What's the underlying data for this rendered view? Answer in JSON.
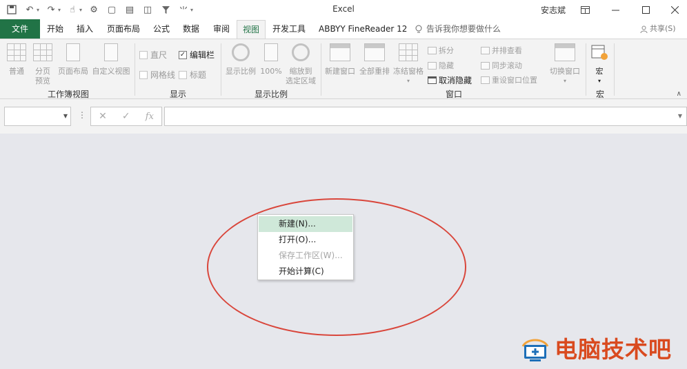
{
  "window": {
    "app_title": "Excel",
    "user_name": "安志斌"
  },
  "tabs": {
    "file": "文件",
    "home": "开始",
    "insert": "插入",
    "page_layout": "页面布局",
    "formulas": "公式",
    "data": "数据",
    "review": "审阅",
    "view": "视图",
    "developer": "开发工具",
    "abbyy": "ABBYY FineReader 12",
    "tell_me": "告诉我你想要做什么",
    "share": "共享(S)"
  },
  "ribbon": {
    "workbook_views": {
      "label": "工作簿视图",
      "normal": "普通",
      "page_break_line1": "分页",
      "page_break_line2": "预览",
      "page_layout": "页面布局",
      "custom_views": "自定义视图"
    },
    "show": {
      "label": "显示",
      "ruler": "直尺",
      "formula_bar": "编辑栏",
      "gridlines": "网格线",
      "headings": "标题",
      "formula_bar_checked": true
    },
    "zoom": {
      "label": "显示比例",
      "zoom": "显示比例",
      "hundred": "100%",
      "zoom_selection_line1": "缩放到",
      "zoom_selection_line2": "选定区域"
    },
    "window": {
      "label": "窗口",
      "new_window": "新建窗口",
      "arrange_all": "全部重排",
      "freeze_panes": "冻结窗格",
      "split": "拆分",
      "hide": "隐藏",
      "unhide": "取消隐藏",
      "side_by_side": "并排查看",
      "sync_scroll": "同步滚动",
      "reset_position": "重设窗口位置",
      "switch_windows": "切换窗口"
    },
    "macros": {
      "label": "宏",
      "macros": "宏"
    }
  },
  "formula_bar": {
    "name_box_value": "",
    "formula_value": "",
    "fx": "fx"
  },
  "context_menu": {
    "items": [
      {
        "label": "新建(N)...",
        "state": "highlighted"
      },
      {
        "label": "打开(O)...",
        "state": "normal"
      },
      {
        "label": "保存工作区(W)...",
        "state": "disabled"
      },
      {
        "label": "开始计算(C)",
        "state": "normal"
      }
    ]
  },
  "watermark": {
    "text": "电脑技术吧"
  },
  "colors": {
    "accent": "#217346",
    "highlight": "#cfe8d9",
    "annotation": "#d9463b",
    "watermark": "#d94a1f"
  }
}
